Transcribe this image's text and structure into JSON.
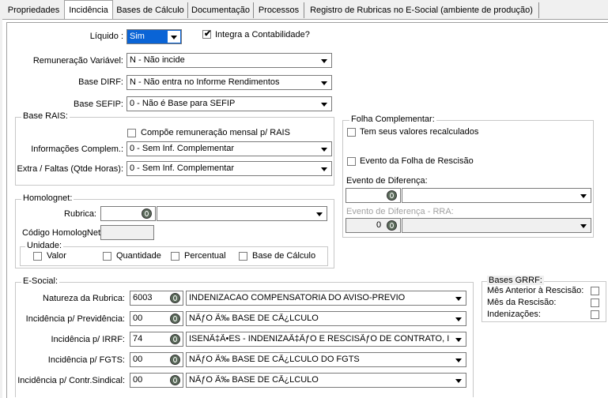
{
  "tabs": [
    {
      "label": "Propriedades"
    },
    {
      "label": "Incidência"
    },
    {
      "label": "Bases de Cálculo"
    },
    {
      "label": "Documentação"
    },
    {
      "label": "Processos"
    },
    {
      "label": "Registro de Rubricas no E-Social (ambiente de produção)"
    }
  ],
  "top": {
    "liquido_label": "Líquido :",
    "liquido_value": "Sim",
    "integra_label": "Integra a Contabilidade?",
    "remuneracao_label": "Remuneração Variável:",
    "remuneracao_value": "N - Não incide",
    "dirf_label": "Base DIRF:",
    "dirf_value": "N - Não entra no Informe Rendimentos",
    "sefip_label": "Base SEFIP:",
    "sefip_value": "0 - Não é Base para SEFIP"
  },
  "rais": {
    "title": "Base RAIS:",
    "compoe_label": "Compõe remuneração mensal p/ RAIS",
    "info_label": "Informações Complem.:",
    "info_value": "0 - Sem Inf. Complementar",
    "extra_label": "Extra / Faltas (Qtde Horas):",
    "extra_value": "0 - Sem Inf. Complementar"
  },
  "folha": {
    "title": "Folha Complementar:",
    "recalc_label": "Tem seus valores recalculados",
    "rescisao_label": "Evento da Folha de Rescisão",
    "evento_dif_label": "Evento de Diferença:",
    "evento_rra_label": "Evento de Diferença - RRA:",
    "evento_rra_code": "0"
  },
  "homolognet": {
    "title": "Homolognet:",
    "rubrica_label": "Rubrica:",
    "codigo_label": "Código HomologNet",
    "unidade_title": "Unidade:",
    "opt_valor": "Valor",
    "opt_quantidade": "Quantidade",
    "opt_percentual": "Percentual",
    "opt_base": "Base de Cálculo"
  },
  "esocial": {
    "title": "E-Social:",
    "rows": [
      {
        "label": "Natureza da Rubrica:",
        "code": "6003",
        "value": "INDENIZACAO COMPENSATORIA DO AVISO-PREVIO"
      },
      {
        "label": "Incidência p/ Previdência:",
        "code": "00",
        "value": "NÃƒO Ã‰ BASE DE CÃ¿LCULO"
      },
      {
        "label": "Incidência p/ IRRF:",
        "code": "74",
        "value": "ISENÃ‡Ã•ES - INDENIZAÃ‡ÃƒO E RESCISÃƒO DE CONTRATO, INCLU"
      },
      {
        "label": "Incidência p/ FGTS:",
        "code": "00",
        "value": "NÃƒO Ã‰ BASE DE CÃ¿LCULO DO FGTS"
      },
      {
        "label": "Incidência p/ Contr.Sindical:",
        "code": "00",
        "value": "NÃƒO Ã‰ BASE DE CÃ¿LCULO"
      }
    ]
  },
  "grrf": {
    "title": "Bases GRRF:",
    "mes_anterior": "Mês Anterior à Rescisão:",
    "mes_rescisao": "Mês da Rescisão:",
    "indenizacoes": "Indenizações:"
  }
}
